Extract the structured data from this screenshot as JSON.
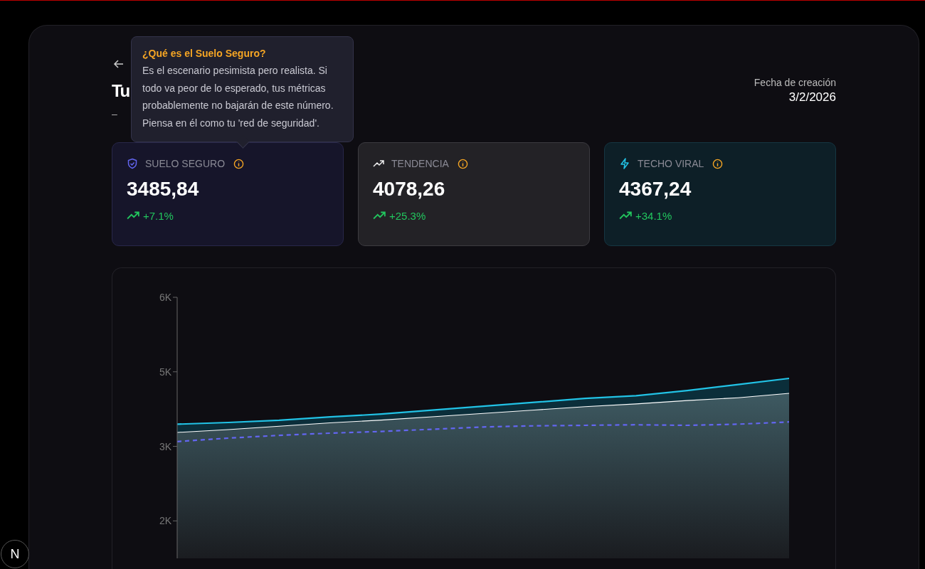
{
  "header": {
    "title": "Tu",
    "subtitle": "–",
    "created_label": "Fecha de creación",
    "created_date": "3/2/2026"
  },
  "tooltip": {
    "title": "¿Qué es el Suelo Seguro?",
    "text": "Es el escenario pesimista pero realista. Si todo va peor de lo esperado, tus métricas probablemente no bajarán de este número. Piensa en él como tu 'red de seguridad'."
  },
  "cards": [
    {
      "kind": "safe",
      "label": "SUELO SEGURO",
      "value": "3485,84",
      "change": "+7.1%"
    },
    {
      "kind": "trend",
      "label": "TENDENCIA",
      "value": "4078,26",
      "change": "+25.3%"
    },
    {
      "kind": "viral",
      "label": "TECHO VIRAL",
      "value": "4367,24",
      "change": "+34.1%"
    }
  ],
  "chart": {
    "chart_data": {
      "type": "area",
      "ylim": [
        1330,
        6000
      ],
      "yticks": [
        {
          "value": 6000,
          "label": "6K"
        },
        {
          "value": 4667,
          "label": "5K"
        },
        {
          "value": 3333,
          "label": "3K"
        },
        {
          "value": 2000,
          "label": "2K"
        }
      ],
      "series": [
        {
          "type": "area",
          "color": "#22c3e6",
          "values": [
            3730,
            3760,
            3800,
            3860,
            3910,
            3980,
            4050,
            4120,
            4190,
            4240,
            4330,
            4440,
            4550
          ]
        },
        {
          "type": "area",
          "color": "#ffffff",
          "values": [
            3590,
            3640,
            3700,
            3760,
            3810,
            3870,
            3930,
            3990,
            4050,
            4100,
            4160,
            4210,
            4290
          ]
        },
        {
          "type": "line",
          "line_style": "dashed",
          "color": "#6366f1",
          "values": [
            3420,
            3480,
            3530,
            3570,
            3600,
            3640,
            3680,
            3700,
            3710,
            3720,
            3710,
            3730,
            3770
          ]
        }
      ]
    }
  },
  "dev_badge": "N"
}
